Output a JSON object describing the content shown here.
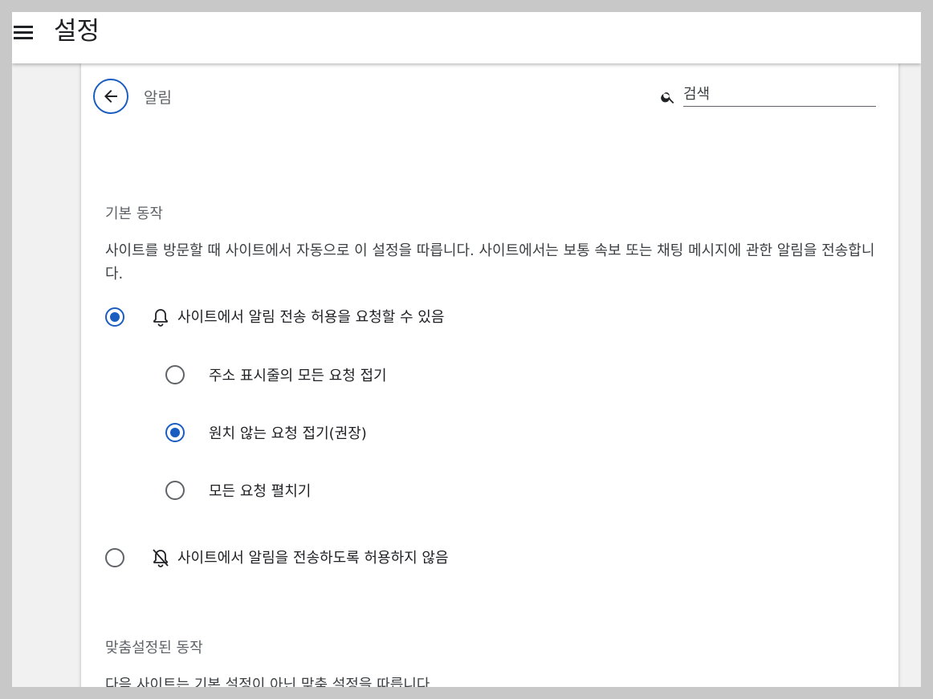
{
  "header": {
    "title": "설정"
  },
  "subpage": {
    "title": "알림",
    "search": {
      "placeholder": "검색",
      "value": ""
    }
  },
  "default_behavior": {
    "heading": "기본 동작",
    "description": "사이트를 방문할 때 사이트에서 자동으로 이 설정을 따릅니다. 사이트에서는 보통 속보 또는 채팅 메시지에 관한 알림을 전송합니다.",
    "options": [
      {
        "label": "사이트에서 알림 전송 허용을 요청할 수 있음",
        "icon": "bell-icon",
        "checked": true,
        "sub_options": [
          {
            "label": "주소 표시줄의 모든 요청 접기",
            "checked": false
          },
          {
            "label": "원치 않는 요청 접기(권장)",
            "checked": true
          },
          {
            "label": "모든 요청 펼치기",
            "checked": false
          }
        ]
      },
      {
        "label": "사이트에서 알림을 전송하도록 허용하지 않음",
        "icon": "bell-off-icon",
        "checked": false
      }
    ]
  },
  "custom_behavior": {
    "heading": "맞춤설정된 동작",
    "description": "다음 사이트는 기본 설정이 아닌 맞춤 설정을 따릅니다."
  },
  "colors": {
    "accent": "#1a5dc1",
    "text": "#202124",
    "secondary": "#5f6368"
  }
}
